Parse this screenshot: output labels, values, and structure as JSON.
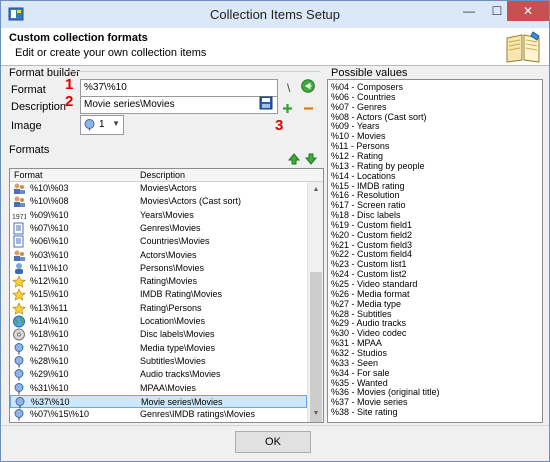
{
  "window": {
    "title": "Collection Items Setup",
    "app_icon": "app-icon",
    "controls": {
      "minimize": "—",
      "maximize": "☐",
      "close": "✕"
    }
  },
  "header": {
    "title": "Custom collection formats",
    "subtitle": "Edit or create your own collection items",
    "icon": "book-icon"
  },
  "format_builder": {
    "group_label": "Format builder",
    "format_label": "Format",
    "format_value": "%37\\%10",
    "description_label": "Description",
    "description_value": "Movie series\\Movies",
    "image_label": "Image",
    "image_value": "1",
    "separator": "\\",
    "annotations": [
      "1",
      "2",
      "3"
    ]
  },
  "formats": {
    "group_label": "Formats",
    "columns": [
      "Format",
      "Description"
    ],
    "rows": [
      {
        "icon": "actors-icon",
        "format": "%10\\%03",
        "description": "Movies\\Actors"
      },
      {
        "icon": "actors-icon",
        "format": "%10\\%08",
        "description": "Movies\\Actors (Cast sort)"
      },
      {
        "icon": "year-icon",
        "format": "%09\\%10",
        "description": "Years\\Movies"
      },
      {
        "icon": "document-icon",
        "format": "%07\\%10",
        "description": "Genres\\Movies"
      },
      {
        "icon": "document-icon",
        "format": "%06\\%10",
        "description": "Countries\\Movies"
      },
      {
        "icon": "actors-icon",
        "format": "%03\\%10",
        "description": "Actors\\Movies"
      },
      {
        "icon": "persons-icon",
        "format": "%11\\%10",
        "description": "Persons\\Movies"
      },
      {
        "icon": "star-icon",
        "format": "%12\\%10",
        "description": "Rating\\Movies"
      },
      {
        "icon": "star-icon",
        "format": "%15\\%10",
        "description": "IMDB Rating\\Movies"
      },
      {
        "icon": "star-icon",
        "format": "%13\\%11",
        "description": "Rating\\Persons"
      },
      {
        "icon": "globe-icon",
        "format": "%14\\%10",
        "description": "Location\\Movies"
      },
      {
        "icon": "disc-icon",
        "format": "%18\\%10",
        "description": "Disc labels\\Movies"
      },
      {
        "icon": "pin-icon",
        "format": "%27\\%10",
        "description": "Media type\\Movies"
      },
      {
        "icon": "pin-icon",
        "format": "%28\\%10",
        "description": "Subtitles\\Movies"
      },
      {
        "icon": "pin-icon",
        "format": "%29\\%10",
        "description": "Audio tracks\\Movies"
      },
      {
        "icon": "pin-icon",
        "format": "%31\\%10",
        "description": "MPAA\\Movies"
      },
      {
        "icon": "pin-icon",
        "format": "%37\\%10",
        "description": "Movie series\\Movies",
        "selected": true
      },
      {
        "icon": "pin-icon",
        "format": "%07\\%15\\%10",
        "description": "Genres\\IMDB ratings\\Movies"
      }
    ]
  },
  "possible_values": {
    "group_label": "Possible values",
    "items": [
      "%04 - Composers",
      "%06 - Countries",
      "%07 - Genres",
      "%08 - Actors (Cast sort)",
      "%09 - Years",
      "%10 - Movies",
      "%11 - Persons",
      "%12 - Rating",
      "%13 - Rating by people",
      "%14 - Locations",
      "%15 - IMDB rating",
      "%16 - Resolution",
      "%17 - Screen ratio",
      "%18 - Disc labels",
      "%19 - Custom field1",
      "%20 - Custom field2",
      "%21 - Custom field3",
      "%22 - Custom field4",
      "%23 - Custom list1",
      "%24 - Custom list2",
      "%25 - Video standard",
      "%26 - Media format",
      "%27 - Media type",
      "%28 - Subtitles",
      "%29 - Audio tracks",
      "%30 - Video codec",
      "%31 - MPAA",
      "%32 - Studios",
      "%33 - Seen",
      "%34 - For sale",
      "%35 - Wanted",
      "%36 - Movies (original title)",
      "%37 - Movie series",
      "%38 - Site rating"
    ]
  },
  "footer": {
    "ok_label": "OK"
  },
  "colors": {
    "accent_red": "#dd0000",
    "selection": "#cce8ff",
    "header_bg": "#ffffff",
    "title_bar": "#dae8f7"
  }
}
